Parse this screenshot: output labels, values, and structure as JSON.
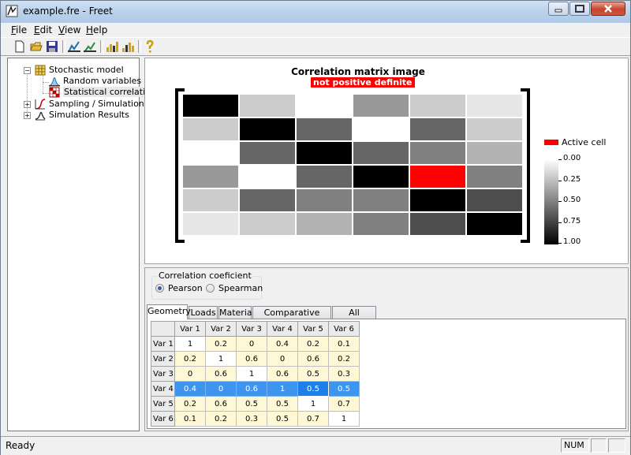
{
  "window": {
    "title": "example.fre - Freet"
  },
  "menu": [
    {
      "label": "File",
      "ul": "F",
      "rest": "ile"
    },
    {
      "label": "Edit",
      "ul": "E",
      "rest": "dit"
    },
    {
      "label": "View",
      "ul": "V",
      "rest": "iew"
    },
    {
      "label": "Help",
      "ul": "H",
      "rest": "elp"
    }
  ],
  "toolbar": {
    "icons": [
      "new-file-icon",
      "open-folder-icon",
      "save-icon",
      "run-icon",
      "run-step-icon",
      "bar-chart-icon",
      "bar-chart-alt-icon",
      "help-icon"
    ]
  },
  "tree": {
    "items": [
      {
        "label": "Stochastic model",
        "icon": "grid-icon"
      },
      {
        "label": "Random variables",
        "icon": "distribution-icon"
      },
      {
        "label": "Statistical correlation",
        "icon": "correlation-matrix-icon",
        "selected": true
      },
      {
        "label": "Sampling / Simulation",
        "icon": "sampling-icon"
      },
      {
        "label": "Simulation Results",
        "icon": "results-icon"
      }
    ]
  },
  "chart": {
    "title": "Correlation matrix image",
    "subtitle": "not positive definite",
    "legend_active": "Active cell",
    "colorbar_labels": [
      "0.00",
      "0.25",
      "0.50",
      "0.75",
      "1.00"
    ]
  },
  "chart_data": {
    "type": "heatmap",
    "title": "Correlation matrix image",
    "subtitle": "not positive definite",
    "rows": [
      "Var 1",
      "Var 2",
      "Var 3",
      "Var 4",
      "Var 5",
      "Var 6"
    ],
    "cols": [
      "Var 1",
      "Var 2",
      "Var 3",
      "Var 4",
      "Var 5",
      "Var 6"
    ],
    "values": [
      [
        1,
        0.2,
        0,
        0.4,
        0.2,
        0.1
      ],
      [
        0.2,
        1,
        0.6,
        0,
        0.6,
        0.2
      ],
      [
        0,
        0.6,
        1,
        0.6,
        0.5,
        0.3
      ],
      [
        0.4,
        0,
        0.6,
        1,
        0.5,
        0.5
      ],
      [
        0.2,
        0.6,
        0.5,
        0.5,
        1,
        0.7
      ],
      [
        0.1,
        0.2,
        0.3,
        0.5,
        0.7,
        1
      ]
    ],
    "active_cell": [
      3,
      4
    ],
    "active_color": "#ff0000",
    "color_scale": {
      "min": 0,
      "max": 1,
      "low_color": "#ffffff",
      "high_color": "#000000"
    }
  },
  "correlation": {
    "group_title": "Correlation coeficient",
    "options": [
      "Pearson",
      "Spearman"
    ],
    "selected": "Pearson"
  },
  "tabs": [
    "Geometry",
    "Loads",
    "Material",
    "Comparative values",
    "All variables"
  ],
  "active_tab": "Geometry",
  "grid": {
    "col_headers": [
      "Var 1",
      "Var 2",
      "Var 3",
      "Var 4",
      "Var 5",
      "Var 6"
    ],
    "rows": [
      {
        "header": "Var 1",
        "cells": [
          "1",
          "0.2",
          "0",
          "0.4",
          "0.2",
          "0.1"
        ]
      },
      {
        "header": "Var 2",
        "cells": [
          "0.2",
          "1",
          "0.6",
          "0",
          "0.6",
          "0.2"
        ]
      },
      {
        "header": "Var 3",
        "cells": [
          "0",
          "0.6",
          "1",
          "0.6",
          "0.5",
          "0.3"
        ]
      },
      {
        "header": "Var 4",
        "cells": [
          "0.4",
          "0",
          "0.6",
          "1",
          "0.5",
          "0.5"
        ]
      },
      {
        "header": "Var 5",
        "cells": [
          "0.2",
          "0.6",
          "0.5",
          "0.5",
          "1",
          "0.7"
        ]
      },
      {
        "header": "Var 6",
        "cells": [
          "0.1",
          "0.2",
          "0.3",
          "0.5",
          "0.7",
          "1"
        ]
      }
    ],
    "selected_row": 3,
    "focus_col": 4
  },
  "status": {
    "text": "Ready",
    "indicator": "NUM"
  }
}
